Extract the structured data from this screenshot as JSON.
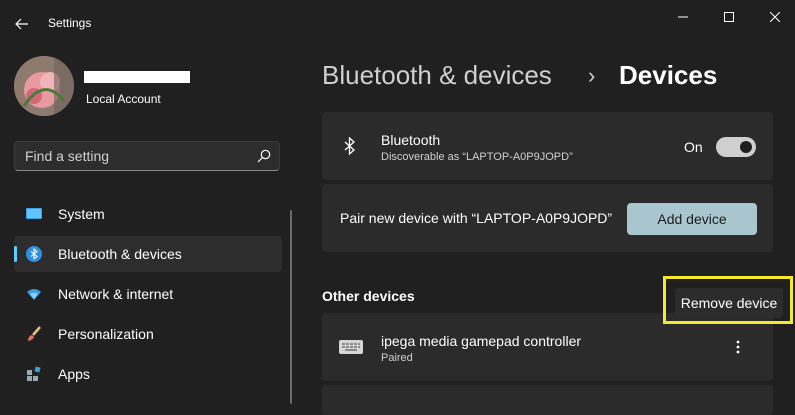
{
  "window": {
    "title": "Settings"
  },
  "profile": {
    "account_type": "Local Account"
  },
  "search": {
    "placeholder": "Find a setting"
  },
  "nav": {
    "items": [
      {
        "label": "System",
        "icon": "monitor-icon"
      },
      {
        "label": "Bluetooth & devices",
        "icon": "bluetooth-icon",
        "selected": true
      },
      {
        "label": "Network & internet",
        "icon": "wifi-icon"
      },
      {
        "label": "Personalization",
        "icon": "paintbrush-icon"
      },
      {
        "label": "Apps",
        "icon": "apps-icon"
      }
    ]
  },
  "breadcrumb": {
    "parent": "Bluetooth & devices",
    "separator": "›",
    "current": "Devices"
  },
  "bluetooth_card": {
    "title": "Bluetooth",
    "subtitle": "Discoverable as “LAPTOP-A0P9JOPD”",
    "state_label": "On",
    "enabled": true
  },
  "pair_card": {
    "text": "Pair new device with “LAPTOP-A0P9JOPD”",
    "button_label": "Add device"
  },
  "other_devices": {
    "heading": "Other devices",
    "items": [
      {
        "name": "ipega media gamepad controller",
        "status": "Paired",
        "icon": "keyboard-icon"
      }
    ]
  },
  "context_menu": {
    "items": [
      "Remove device"
    ]
  },
  "colors": {
    "background": "#202020",
    "card": "#2b2b2b",
    "accent": "#60cdff",
    "button": "#a9c6cf",
    "highlight": "#f5ea2a"
  }
}
